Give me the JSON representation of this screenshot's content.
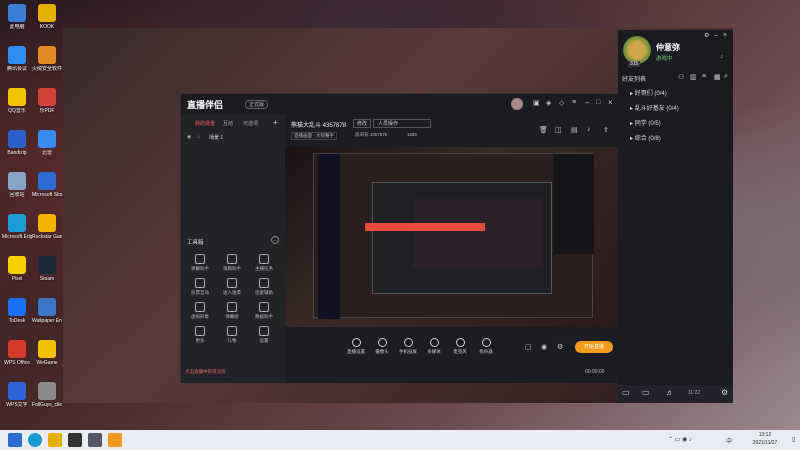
{
  "desktop": {
    "icons": [
      {
        "label": "此电脑",
        "color": "#3b7ed8"
      },
      {
        "label": "腾讯会议",
        "color": "#2f8cf0"
      },
      {
        "label": "QQ音乐",
        "color": "#f5c400"
      },
      {
        "label": "Bandizip",
        "color": "#2a62c9"
      },
      {
        "label": "回收站",
        "color": "#8aa4c8"
      },
      {
        "label": "Microsoft Edge",
        "color": "#1b9bd8"
      },
      {
        "label": "Pixel",
        "color": "#f7d000"
      },
      {
        "label": "ToDesk",
        "color": "#1870f5"
      },
      {
        "label": "WPS Office",
        "color": "#d33a2c"
      },
      {
        "label": "WPS文字",
        "color": "#2c62d9"
      },
      {
        "label": "KOOK",
        "color": "#e6b000"
      },
      {
        "label": "火绒安全软件",
        "color": "#e58a1f"
      },
      {
        "label": "乐PDF",
        "color": "#d4433a"
      },
      {
        "label": "迅雷",
        "color": "#3a8af0"
      },
      {
        "label": "Microsoft Store",
        "color": "#2a6cd0"
      },
      {
        "label": "Rockstar Games...",
        "color": "#f2b400"
      },
      {
        "label": "Steam",
        "color": "#1b2838"
      },
      {
        "label": "Wallpaper Engine...",
        "color": "#3a77c8"
      },
      {
        "label": "WeGame",
        "color": "#f2c200"
      },
      {
        "label": "FallGuys_client_...",
        "color": "#8a8a8a"
      }
    ]
  },
  "app": {
    "name": "直播伴侣",
    "version": "正式版",
    "tabs": [
      "我的场景",
      "互动",
      "可选项"
    ],
    "scene": "场景 1",
    "room_title": "熊猫大乱斗 4357878",
    "edit_label": "修改",
    "mode_label": "人员操作",
    "stream_source": "直播画面 · 大师赛手",
    "room_id": "房间号 4357878",
    "fans": "1590",
    "tools_heading": "工具箱",
    "tools": [
      {
        "label": "弹幕助手"
      },
      {
        "label": "观看助手"
      },
      {
        "label": "主播任务"
      },
      {
        "label": "投票互动"
      },
      {
        "label": "送人送票"
      },
      {
        "label": "连麦辅助"
      },
      {
        "label": "虚拟形象"
      },
      {
        "label": "弹幕姬"
      },
      {
        "label": "数据助手"
      },
      {
        "label": "更多"
      },
      {
        "label": "礼物"
      },
      {
        "label": "设置"
      }
    ],
    "bottom_buttons": [
      "直播设置",
      "摄像头",
      "手机投屏",
      "多媒体",
      "麦克风",
      "扬声器"
    ],
    "start_button": "开始直播",
    "notice": "点击直播中获得流程",
    "timer": "00:00:00"
  },
  "buddy": {
    "name": "仲意弥",
    "status": "游戏中",
    "level": "315",
    "list_title": "好友列表",
    "groups": [
      {
        "label": "好哥们 (0/4)"
      },
      {
        "label": "乱斗好基友 (0/4)"
      },
      {
        "label": "同学 (0/5)"
      },
      {
        "label": "综合 (0/8)"
      }
    ],
    "bottom_time": "11:22"
  },
  "taskbar": {
    "time": "13:12",
    "date": "2021/11/27",
    "lang": "中"
  }
}
